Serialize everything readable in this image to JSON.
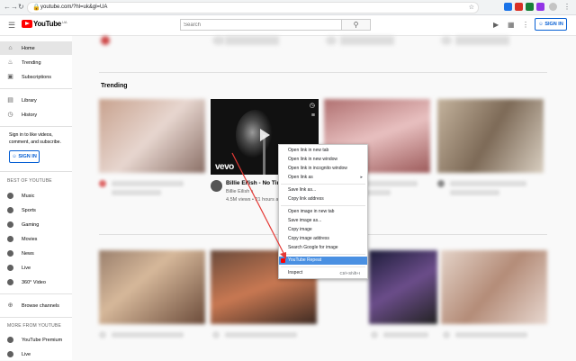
{
  "browser": {
    "url": "youtube.com/?hl=uk&gl=UA"
  },
  "header": {
    "logo_text": "YouTube",
    "logo_sup": "UA",
    "search_placeholder": "Search",
    "signin_label": "SIGN IN"
  },
  "sidebar": {
    "items_top": [
      {
        "label": "Home",
        "icon": "home-icon"
      },
      {
        "label": "Trending",
        "icon": "trending-icon"
      },
      {
        "label": "Subscriptions",
        "icon": "subscriptions-icon"
      }
    ],
    "items_library": [
      {
        "label": "Library",
        "icon": "library-icon"
      },
      {
        "label": "History",
        "icon": "history-icon"
      }
    ],
    "signin_note": "Sign in to like videos, comment, and subscribe.",
    "signin_label": "SIGN IN",
    "best_heading": "BEST OF YOUTUBE",
    "best_items": [
      {
        "label": "Music",
        "icon": "music-icon"
      },
      {
        "label": "Sports",
        "icon": "sports-icon"
      },
      {
        "label": "Gaming",
        "icon": "gaming-icon"
      },
      {
        "label": "Movies",
        "icon": "movies-icon"
      },
      {
        "label": "News",
        "icon": "news-icon"
      },
      {
        "label": "Live",
        "icon": "live-icon"
      },
      {
        "label": "360° Video",
        "icon": "360-icon"
      }
    ],
    "browse_channels": "Browse channels",
    "more_heading": "MORE FROM YOUTUBE",
    "more_items": [
      {
        "label": "YouTube Premium",
        "icon": "premium-icon"
      },
      {
        "label": "Live",
        "icon": "live-icon"
      }
    ]
  },
  "main": {
    "section_title": "Trending",
    "video": {
      "title": "Billie Eilish - No Time To",
      "channel": "Billie Eilish ♪",
      "meta": "4.5M views • 21 hours ago",
      "brand": "vevo"
    }
  },
  "context_menu": {
    "items": [
      {
        "label": "Open link in new tab"
      },
      {
        "label": "Open link in new window"
      },
      {
        "label": "Open link in incognito window"
      },
      {
        "label": "Open link as",
        "submenu": true
      },
      {
        "label": "Save link as..."
      },
      {
        "label": "Copy link address"
      },
      {
        "label": "Open image in new tab"
      },
      {
        "label": "Save image as..."
      },
      {
        "label": "Copy image"
      },
      {
        "label": "Copy image address"
      },
      {
        "label": "Search Google for image"
      },
      {
        "label": "YouTube Repeat",
        "highlighted": true
      },
      {
        "label": "Inspect",
        "shortcut": "Ctrl+Shift+I"
      }
    ]
  },
  "colors": {
    "accent": "#065fd4",
    "brand_red": "#ff0000",
    "highlight": "#4a90e2",
    "arrow": "#e53935"
  }
}
